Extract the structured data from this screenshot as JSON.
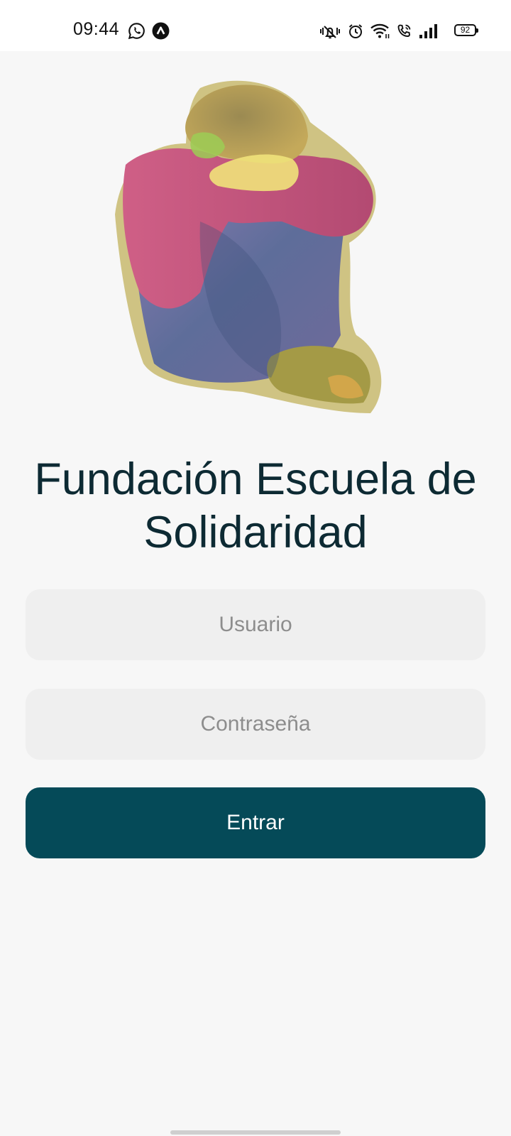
{
  "status_bar": {
    "time": "09:44",
    "battery": "92",
    "left_icons": [
      "whatsapp-icon",
      "app-notification-icon"
    ],
    "right_icons": [
      "mute-vibrate-icon",
      "alarm-icon",
      "wifi-icon",
      "wifi-calling-icon",
      "signal-icon",
      "battery-icon"
    ]
  },
  "logo": {
    "icon": "child-watercolor-illustration"
  },
  "app": {
    "title": "Fundación Escuela de Solidaridad"
  },
  "login_form": {
    "username_placeholder": "Usuario",
    "username_value": "",
    "password_placeholder": "Contraseña",
    "password_value": "",
    "submit_label": "Entrar"
  },
  "colors": {
    "background": "#f7f7f7",
    "title": "#0d2a33",
    "input_background": "#efefef",
    "button": "#054a58",
    "button_text": "#ffffff"
  }
}
